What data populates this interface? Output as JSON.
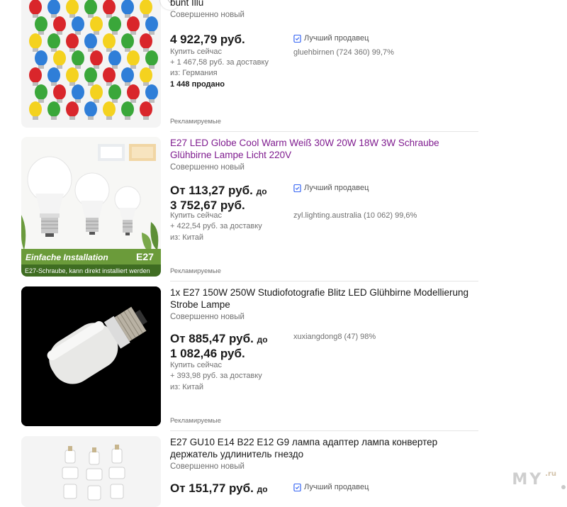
{
  "listings": [
    {
      "title": "bunt Illu",
      "condition": "Совершенно новый",
      "price": "4 922,79 руб.",
      "buy_type": "Купить сейчас",
      "shipping": "+ 1 467,58 руб. за доставку",
      "origin": "из: Германия",
      "sold": "1 448 продано",
      "top_rated": "Лучший продавец",
      "seller": "gluehbirnen (724 360) 99,7%",
      "ad": "Рекламируемые",
      "image_icon": "colorful-bulbs"
    },
    {
      "title": "E27 LED Globe Cool Warm Weiß 30W 20W 18W 3W Schraube Glühbirne Lampe Licht 220V",
      "condition": "Совершенно новый",
      "price_from": "От 113,27 руб.",
      "price_to_word": "до",
      "price_to": "3 752,67 руб.",
      "buy_type": "Купить сейчас",
      "shipping": "+ 422,54 руб. за доставку",
      "origin": "из: Китай",
      "top_rated": "Лучший продавец",
      "seller": "zyl.lighting.australia (10 062) 99,6%",
      "ad": "Рекламируемые",
      "banner_main": "Einfache Installation",
      "banner_tag": "E27",
      "banner_sub": "E27-Schraube, kann direkt installiert werden"
    },
    {
      "title": "1x E27 150W 250W Studiofotografie Blitz LED Glühbirne Modellierung Strobe Lampe",
      "condition": "Совершенно новый",
      "price_from": "От 885,47 руб.",
      "price_to_word": "до",
      "price_to": "1 082,46 руб.",
      "buy_type": "Купить сейчас",
      "shipping": "+ 393,98 руб. за доставку",
      "origin": "из: Китай",
      "seller": "xuxiangdong8 (47) 98%",
      "ad": "Рекламируемые"
    },
    {
      "title": "E27 GU10 E14 B22 E12 G9 лампа адаптер лампа конвертер держатель удлинитель гнездо",
      "condition": "Совершенно новый",
      "price_from": "От 151,77 руб.",
      "price_to_word": "до",
      "top_rated": "Лучший продавец"
    }
  ],
  "watermark": {
    "text": "MY",
    "suffix": ".ru"
  },
  "colors": {
    "visited_link": "#7f1b8f",
    "muted": "#707070",
    "top_rated_icon": "#3665f3"
  },
  "icons": {
    "watch": "heart-icon",
    "top_rated": "top-rated-badge-icon"
  }
}
